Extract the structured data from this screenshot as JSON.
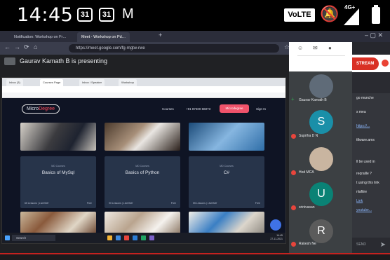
{
  "status_bar": {
    "time": "14:45",
    "badge1": "31",
    "badge2": "31",
    "mail_icon": "M",
    "volte": "VoLTE",
    "signal_label": "4G+"
  },
  "browser": {
    "tabs": [
      "Notification: Workshop on Fr…",
      "Meet - Workshop on Pd…"
    ],
    "url": "https://meet.google.com/fg-mgtw-rwe"
  },
  "meet": {
    "presenting_text": "Gaurav Kamath B is presenting"
  },
  "shared_screen": {
    "tabs": [
      "Inbox (3)",
      "Courses Page",
      "Inbox / Speaker",
      "Workshop"
    ],
    "logo_primary": "Micro",
    "logo_secondary": "Degree",
    "nav": [
      "Courses",
      "+91 87400 66073"
    ],
    "nav_button": "Microdegree",
    "nav_last": "Sign In",
    "cards": [
      {
        "tag": "MD Courses",
        "title": "Basics of MySql",
        "meta": "65 Lessons | Live/Self",
        "price": "Free"
      },
      {
        "tag": "MD Courses",
        "title": "Basics of Python",
        "meta": "90 Lessons | Live/Self",
        "price": "Free"
      },
      {
        "tag": "MD Courses",
        "title": "C#",
        "meta": "55 Lessons | Live/Self",
        "price": "Free"
      }
    ],
    "taskbar_search": "Search",
    "taskbar_time": "14:45",
    "taskbar_date": "27-11-2021"
  },
  "participants": [
    {
      "name": "Gaurav Kamath B",
      "initial": "",
      "color": "#5f6b78"
    },
    {
      "name": "Supriha D N",
      "initial": "S",
      "color": "#1a8fa8"
    },
    {
      "name": "Hod MCA",
      "initial": "",
      "color": "#c9b5a0"
    },
    {
      "name": "srinivasan",
      "initial": "U",
      "color": "#0a8275"
    },
    {
      "name": "Rakesh Ne",
      "initial": "R",
      "color": "#5b5b5b"
    }
  ],
  "right_panel": {
    "live_label": "STREAM",
    "chat_lines": [
      "go munche",
      "s mea",
      "https://...",
      "tftware.ams",
      "ll be used in",
      "reqraille ?",
      "t using this link",
      "nlaftire",
      "Link",
      "youtube..."
    ],
    "input_placeholder": "SEND"
  },
  "colors": {
    "status_bg": "#000000",
    "meet_bg": "#202124",
    "site_bg": "#0f1424",
    "brand_red": "#f0536b",
    "live_red": "#d93025"
  }
}
